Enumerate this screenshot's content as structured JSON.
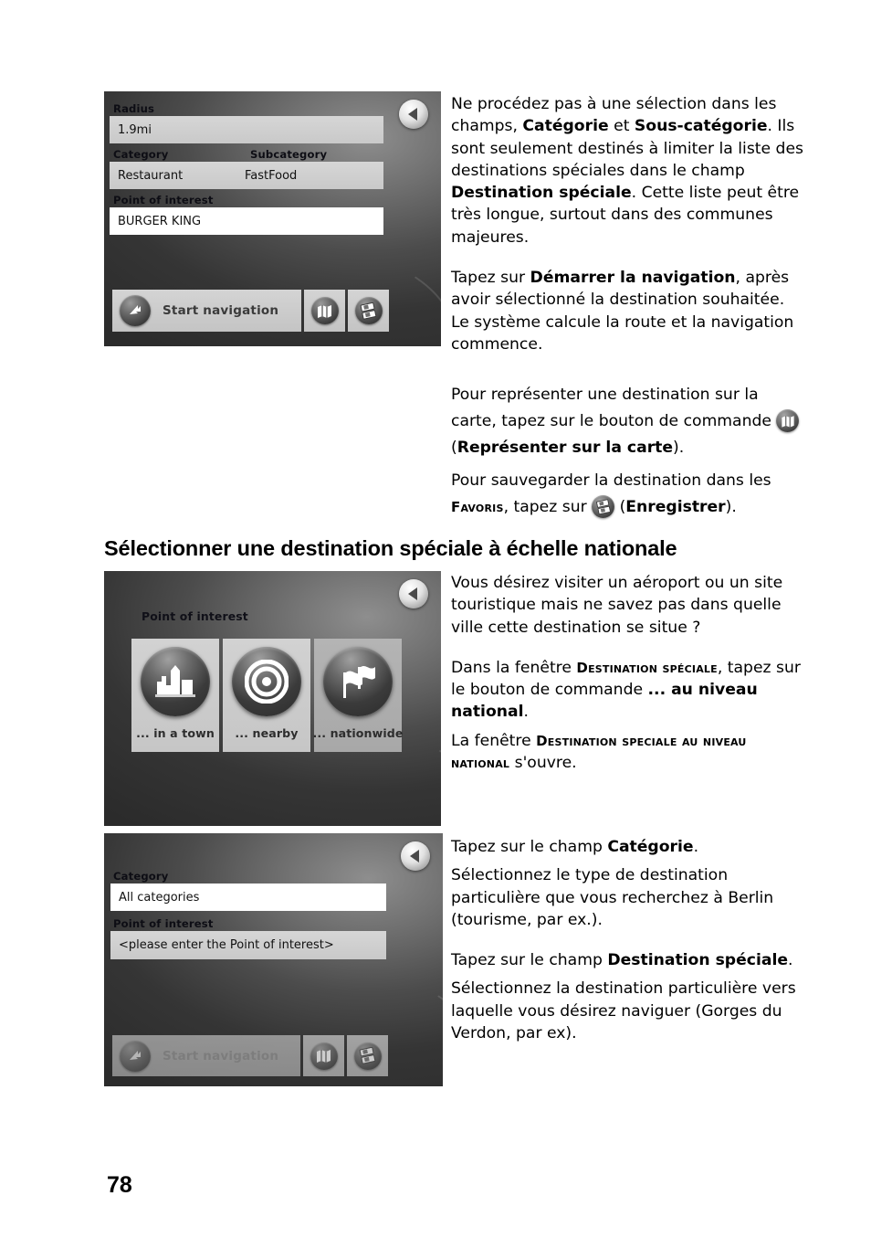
{
  "page": {
    "number": "78"
  },
  "heading": {
    "text": "Sélectionner une destination spéciale à échelle nationale"
  },
  "screenshot_1": {
    "name": "poi-local-result-screen",
    "back_icon": "back-arrow-icon",
    "fields": [
      {
        "label": "Radius",
        "value": "1.9mi"
      },
      {
        "label": "Category",
        "value": "Restaurant"
      },
      {
        "label": "Subcategory",
        "value": "FastFood"
      },
      {
        "label": "Point of interest",
        "value": "BURGER KING"
      }
    ],
    "buttons": {
      "start_navigation": "Start navigation",
      "start_navigation_icon": "navigation-arrow-icon",
      "show_on_map_icon": "map-icon",
      "save_icon": "save-icon"
    }
  },
  "screenshot_2": {
    "name": "poi-scope-chooser-screen",
    "back_icon": "back-arrow-icon",
    "title": "Point of interest",
    "tiles": [
      {
        "label": "... in a town",
        "icon": "city-skyline-icon"
      },
      {
        "label": "... nearby",
        "icon": "target-rings-icon"
      },
      {
        "label": "... nationwide",
        "icon": "flags-icon"
      }
    ]
  },
  "screenshot_3": {
    "name": "poi-nationwide-entry-screen",
    "back_icon": "back-arrow-icon",
    "fields": [
      {
        "label": "Category",
        "value": "All categories"
      },
      {
        "label": "Point of interest",
        "value": "<please enter the Point of interest>"
      }
    ],
    "buttons": {
      "start_navigation": "Start navigation",
      "start_navigation_icon": "navigation-arrow-icon",
      "show_on_map_icon": "map-icon",
      "save_icon": "save-icon"
    }
  },
  "text_block_1": {
    "p1_part1": "Ne procédez pas à une sélection dans les champs, ",
    "p1_bold1": "Catégorie",
    "p1_part2": " et ",
    "p1_bold2": "Sous-catégorie",
    "p1_part3": ". Ils sont seulement destinés à limiter la liste des destinations spéciales dans le champ ",
    "p1_bold3": "Destination spéciale",
    "p1_part4": ". Cette liste peut être très longue, surtout dans des communes majeures.",
    "p2_part1": "Tapez sur ",
    "p2_bold1": "Démarrer la navigation",
    "p2_part2": ", après avoir sélectionné la destination souhaitée. Le système calcule la route et la navigation commence."
  },
  "text_block_2": {
    "p1_part1": "Pour représenter une destination sur la carte, tapez sur le bouton de commande ",
    "p1_part2": " (",
    "p1_bold1": "Représenter sur la carte",
    "p1_part3": ").",
    "p2_part1": "Pour sauvegarder la destination dans les ",
    "p2_sc1": "Favoris",
    "p2_part2": ", tapez sur ",
    "p2_part3": " (",
    "p2_bold1": "Enregistrer",
    "p2_part4": ")."
  },
  "text_block_3": {
    "p1": "Vous désirez visiter un aéroport ou un site touristique mais ne savez pas dans quelle ville cette destination se situe ?",
    "p2_part1": "Dans la fenêtre ",
    "p2_sc1": "Destination spéciale",
    "p2_part2": ", tapez sur le bouton de commande ",
    "p2_bold1": "... au niveau national",
    "p2_part3": ".",
    "p3_part1": "La fenêtre ",
    "p3_sc1": "Destination speciale au niveau national",
    "p3_part2": " s'ouvre."
  },
  "text_block_4": {
    "p1_part1": "Tapez sur le champ ",
    "p1_bold1": "Catégorie",
    "p1_part2": ".",
    "p2": "Sélectionnez le type de destination particulière que vous recherchez à Berlin (tourisme, par ex.).",
    "p3_part1": "Tapez sur le champ ",
    "p3_bold1": "Destination spéciale",
    "p3_part2": ".",
    "p4": "Sélectionnez la destination particulière vers laquelle vous désirez naviguer (Gorges du Verdon, par ex)."
  }
}
